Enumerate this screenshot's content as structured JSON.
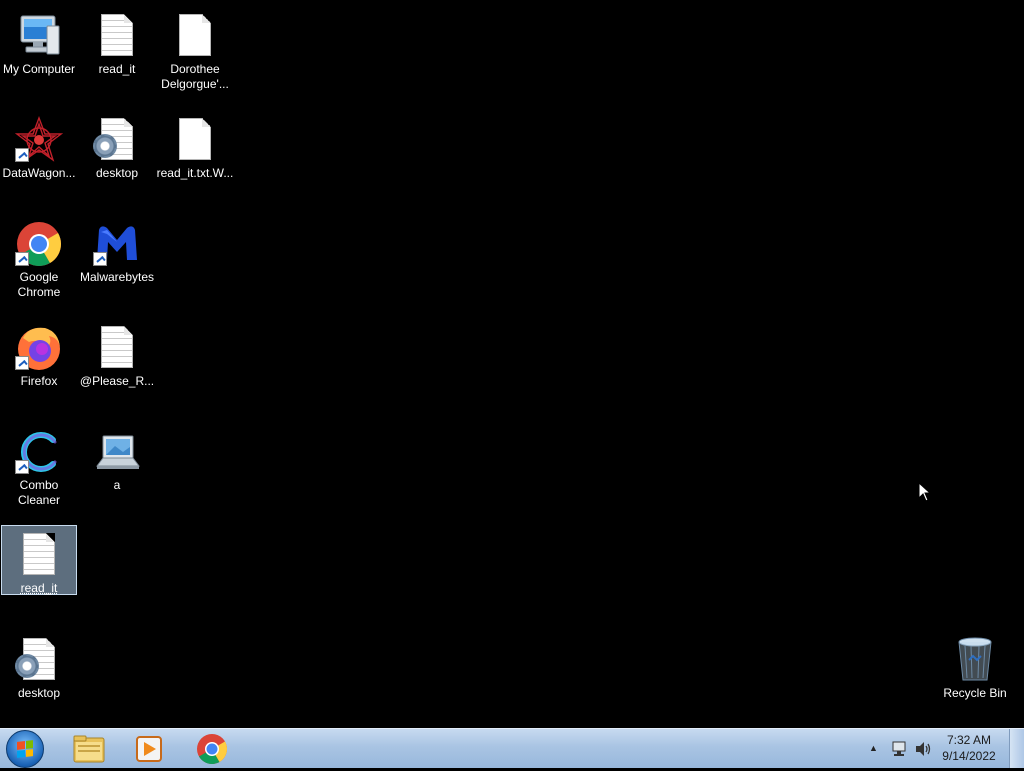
{
  "desktop": {
    "icons": [
      {
        "label": "My Computer"
      },
      {
        "label": "read_it"
      },
      {
        "label": "Dorothee Delgorgue'..."
      },
      {
        "label": "DataWagon..."
      },
      {
        "label": "desktop"
      },
      {
        "label": "read_it.txt.W..."
      },
      {
        "label": "Google Chrome"
      },
      {
        "label": "Malwarebytes"
      },
      {
        "label": "Firefox"
      },
      {
        "label": "@Please_R..."
      },
      {
        "label": "Combo Cleaner"
      },
      {
        "label": "a"
      },
      {
        "label": "read_it",
        "selected": true
      },
      {
        "label": "desktop"
      },
      {
        "label": "Recycle Bin"
      }
    ]
  },
  "taskbar": {
    "start_icon": "windows-orb",
    "pinned": [
      {
        "name": "windows-explorer",
        "icon": "folder-icon"
      },
      {
        "name": "media-player",
        "icon": "media-player-icon"
      },
      {
        "name": "google-chrome",
        "icon": "chrome-icon"
      }
    ],
    "tray": {
      "time": "7:32 AM",
      "date": "9/14/2022"
    }
  },
  "colors": {
    "desktop_background": "#000000",
    "taskbar": "#a9c4e3",
    "selection": "#aac8e6"
  }
}
